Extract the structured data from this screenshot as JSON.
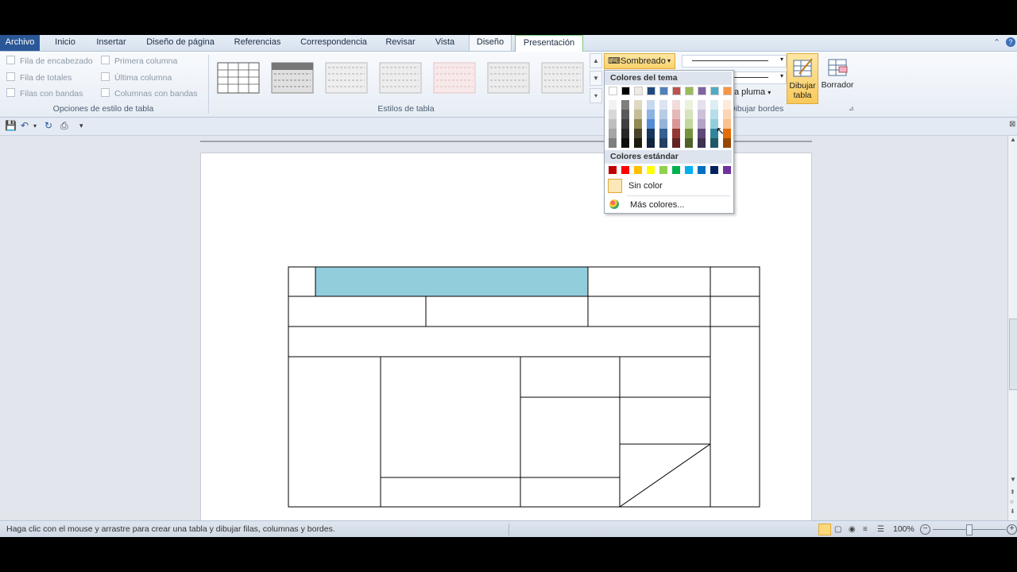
{
  "tabs": {
    "file": "Archivo",
    "items": [
      "Inicio",
      "Insertar",
      "Diseño de página",
      "Referencias",
      "Correspondencia",
      "Revisar",
      "Vista",
      "Diseño",
      "Presentación"
    ]
  },
  "table_style_options": {
    "header_row": "Fila de encabezado",
    "first_column": "Primera columna",
    "total_row": "Fila de totales",
    "last_column": "Última columna",
    "banded_rows": "Filas con bandas",
    "banded_columns": "Columnas con bandas",
    "group_label": "Opciones de estilo de tabla"
  },
  "table_styles": {
    "group_label": "Estilos de tabla"
  },
  "draw_borders": {
    "shading_label": "Sombreado",
    "pen_color_label": "a pluma",
    "draw_table_label": "Dibujar tabla",
    "eraser_label": "Borrador",
    "group_label": "Dibujar bordes"
  },
  "shading_menu": {
    "theme_colors_label": "Colores del tema",
    "standard_colors_label": "Colores estándar",
    "no_color_label": "Sin color",
    "more_colors_label": "Más colores...",
    "theme_top_row": [
      "#ffffff",
      "#000000",
      "#eeece1",
      "#1f497d",
      "#4f81bd",
      "#c0504d",
      "#9bbb59",
      "#8064a2",
      "#4bacc6",
      "#f79646"
    ],
    "theme_shades": [
      [
        "#f2f2f2",
        "#7f7f7f",
        "#ddd9c3",
        "#c6d9f0",
        "#dbe5f1",
        "#f2dcdb",
        "#ebf1dd",
        "#e5e0ec",
        "#dbeef3",
        "#fdeada"
      ],
      [
        "#d8d8d8",
        "#595959",
        "#c4bd97",
        "#8db3e2",
        "#b8cce4",
        "#e5b9b7",
        "#d7e3bc",
        "#ccc1d9",
        "#b7dde8",
        "#fbd5b5"
      ],
      [
        "#bfbfbf",
        "#3f3f3f",
        "#938953",
        "#548dd4",
        "#95b3d7",
        "#d99694",
        "#c3d69b",
        "#b2a2c7",
        "#92cddc",
        "#fac08f"
      ],
      [
        "#a5a5a5",
        "#262626",
        "#494429",
        "#17365d",
        "#366092",
        "#953734",
        "#76923c",
        "#5f497a",
        "#31859b",
        "#e36c09"
      ],
      [
        "#7f7f7f",
        "#0c0c0c",
        "#1d1b10",
        "#0f243e",
        "#244061",
        "#632423",
        "#4f6128",
        "#3f3151",
        "#205867",
        "#974806"
      ]
    ],
    "standard_colors": [
      "#c00000",
      "#ff0000",
      "#ffc000",
      "#ffff00",
      "#92d050",
      "#00b050",
      "#00b0f0",
      "#0070c0",
      "#002060",
      "#7030a0"
    ]
  },
  "document": {
    "shaded_cell_color": "#92cddc"
  },
  "status": {
    "message": "Haga clic con el mouse y arrastre para crear una tabla y dibujar filas, columnas y bordes.",
    "zoom": "100%"
  }
}
